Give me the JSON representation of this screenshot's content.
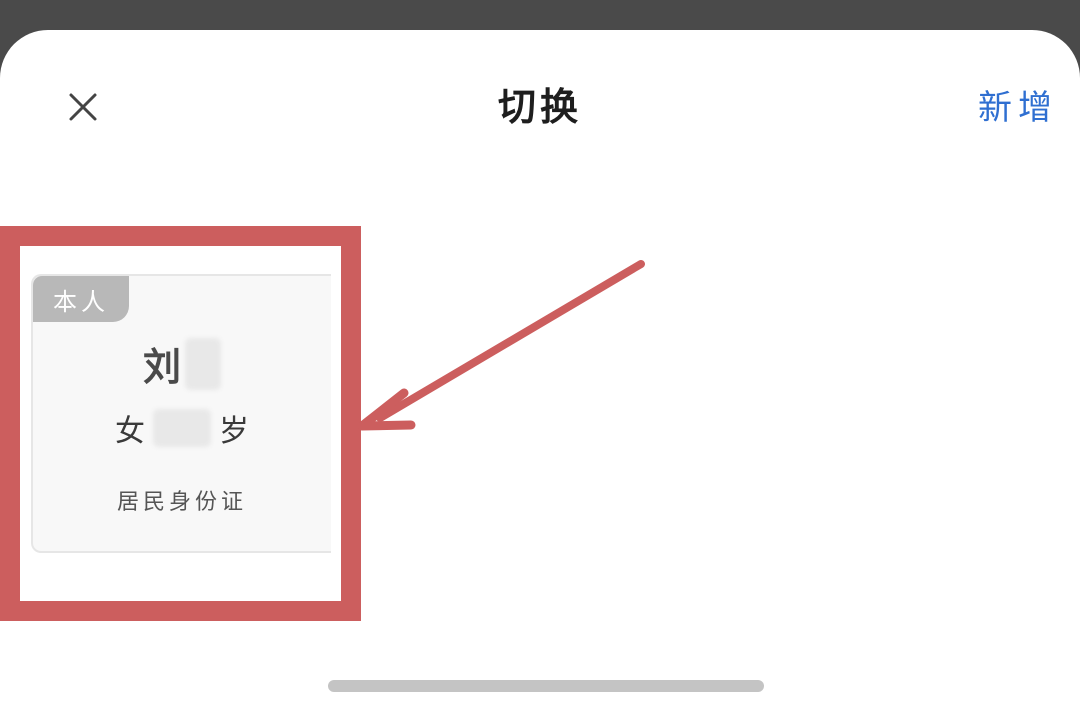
{
  "header": {
    "title": "切换",
    "add_label": "新增",
    "close_icon": "close-icon"
  },
  "card": {
    "badge": "本人",
    "name_visible": "刘",
    "gender": "女",
    "age_unit": "岁",
    "id_type": "居民身份证"
  },
  "colors": {
    "accent": "#2f6fd1",
    "highlight": "#cc5e5e",
    "badge_bg": "#b8b8b8",
    "top_strip": "#4a4a4a"
  }
}
